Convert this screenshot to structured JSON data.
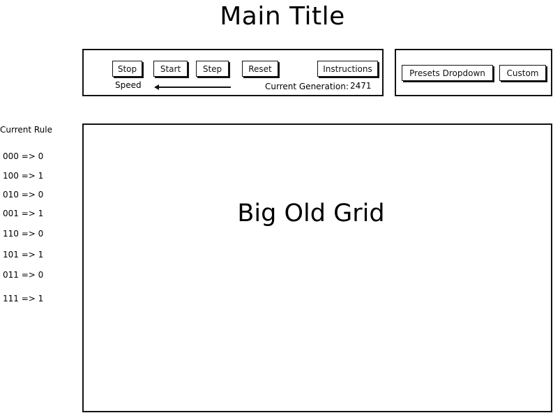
{
  "title": "Main Title",
  "controls": {
    "stop_label": "Stop",
    "start_label": "Start",
    "step_label": "Step",
    "reset_label": "Reset",
    "instructions_label": "Instructions",
    "speed_label": "Speed",
    "speed_value": 0.0,
    "generation_label": "Current Generation:",
    "generation_value": "2471"
  },
  "presets": {
    "dropdown_label": "Presets Dropdown",
    "custom_label": "Custom"
  },
  "rules": {
    "heading": "Current Rule",
    "items": [
      "000 => 0",
      "100 => 1",
      "010 => 0",
      "001 => 1",
      "110 => 0",
      "101 => 1",
      "011 => 0",
      "111 => 1"
    ]
  },
  "grid": {
    "label": "Big Old Grid"
  }
}
